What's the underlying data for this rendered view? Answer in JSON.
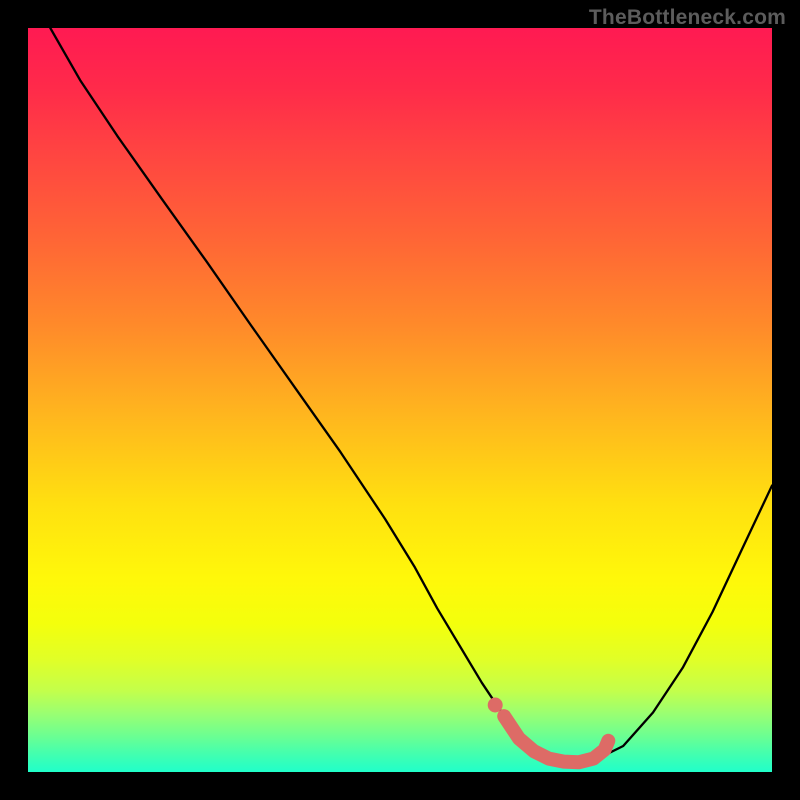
{
  "watermark": "TheBottleneck.com",
  "chart_data": {
    "type": "line",
    "title": "",
    "xlabel": "",
    "ylabel": "",
    "xlim": [
      0,
      100
    ],
    "ylim": [
      0,
      100
    ],
    "series": [
      {
        "name": "bottleneck-curve",
        "x": [
          3,
          7,
          12,
          18,
          24,
          30,
          36,
          42,
          48,
          52,
          55,
          58,
          61,
          64,
          66,
          68,
          70,
          73,
          76,
          80,
          84,
          88,
          92,
          96,
          100
        ],
        "values": [
          100,
          93,
          85.5,
          77,
          68.6,
          60,
          51.5,
          43,
          34,
          27.5,
          22,
          17,
          12,
          7.5,
          4.5,
          2.5,
          1.5,
          1,
          1.5,
          3.5,
          8,
          14,
          21.5,
          30,
          38.5
        ]
      }
    ],
    "highlight": {
      "name": "optimal-range",
      "x": [
        64,
        66,
        68,
        70,
        72,
        74,
        76,
        77.5,
        78
      ],
      "values": [
        7.5,
        4.5,
        2.8,
        1.8,
        1.4,
        1.3,
        1.8,
        3.0,
        4.2
      ]
    },
    "gradient_stops": [
      {
        "pos": 0,
        "color": "#ff1a52"
      },
      {
        "pos": 50,
        "color": "#ffd010"
      },
      {
        "pos": 100,
        "color": "#20ffca"
      }
    ]
  }
}
